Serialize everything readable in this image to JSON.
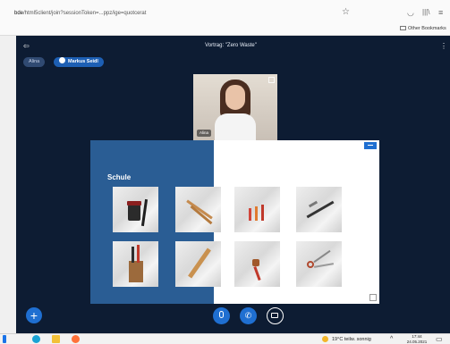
{
  "browser": {
    "url_host": "bde",
    "url_path": "/html5client/join?sessionToken=...ppz/ige=quotcerat",
    "bookmarks_label": "Other Bookmarks",
    "icons": [
      "star-icon",
      "pocket-icon",
      "library-icon",
      "menu-icon"
    ]
  },
  "meeting": {
    "presentation_title": "Vortrag: \"Zero Waste\"",
    "participants": [
      {
        "name": "Alina",
        "talking": false
      },
      {
        "name": "Markus Seidl",
        "talking": true
      }
    ],
    "webcam": {
      "name_label": "Alina"
    }
  },
  "slide": {
    "title": "Schule",
    "photos": [
      "ink bottle with fountain pen",
      "wooden pencils",
      "colored pencils",
      "fountain pen",
      "pencils in cup",
      "wooden ruler",
      "pencil sharpener",
      "scissors"
    ],
    "colors": {
      "panel": "#2a5d94",
      "accent": "#1f6fd1"
    }
  },
  "controls": {
    "add_label": "+",
    "phone_label": "✆"
  },
  "taskbar": {
    "weather": "19°C  teilw. sonnig",
    "time": "17:44",
    "date": "24.05.2021"
  }
}
